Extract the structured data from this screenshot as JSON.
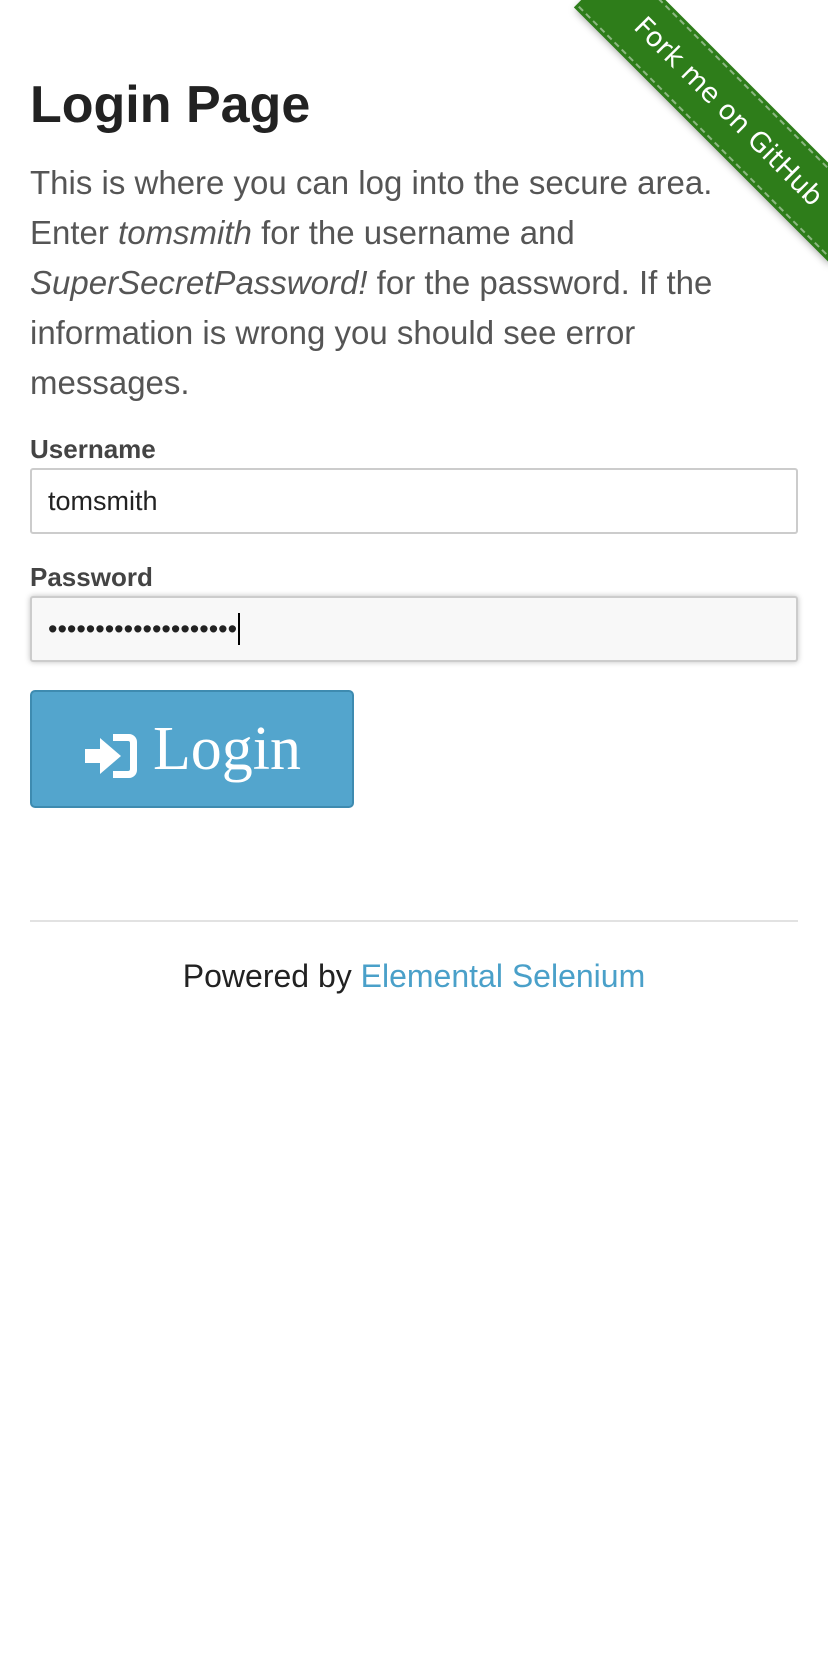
{
  "ribbon": {
    "text": "Fork me on GitHub"
  },
  "page": {
    "title": "Login Page",
    "intro": {
      "part1": "This is where you can log into the secure area. Enter ",
      "username_hint": "tomsmith",
      "part2": " for the username and ",
      "password_hint": "SuperSecretPassword!",
      "part3": " for the password. If the information is wrong you should see error messages."
    }
  },
  "form": {
    "username_label": "Username",
    "username_value": "tomsmith",
    "password_label": "Password",
    "password_masked": "••••••••••••••••••••",
    "login_button": "Login"
  },
  "footer": {
    "powered_by": "Powered by ",
    "link_text": "Elemental Selenium"
  },
  "colors": {
    "ribbon": "#2e7d1a",
    "button": "#53a5cd",
    "link": "#4aa0c9"
  },
  "icons": {
    "login": "sign-in-icon"
  }
}
